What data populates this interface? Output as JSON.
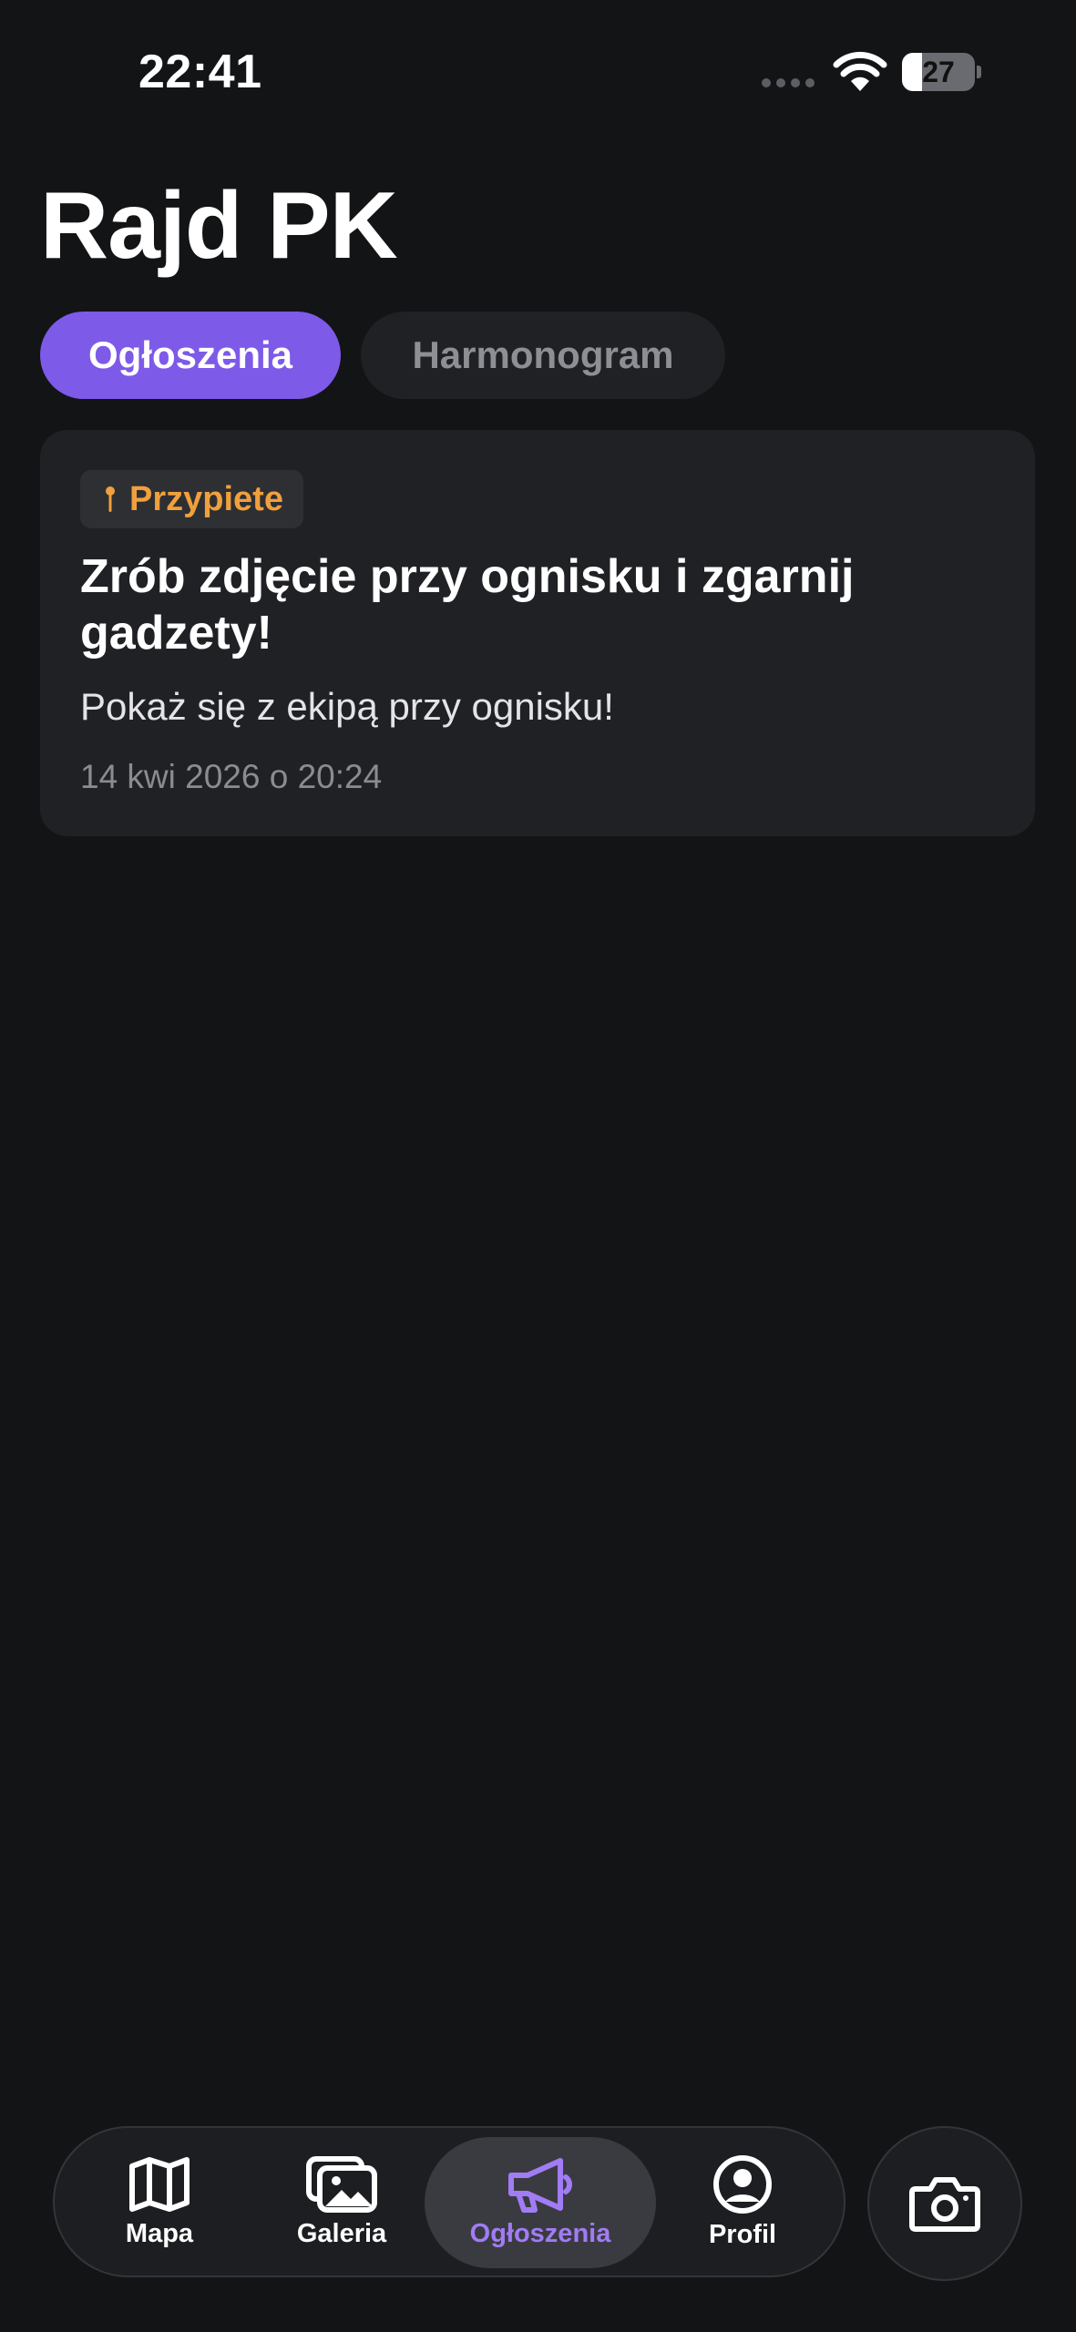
{
  "status_bar": {
    "time": "22:41",
    "battery_level": "27",
    "battery_fraction": 0.27
  },
  "header": {
    "title": "Rajd PK"
  },
  "tabs": [
    {
      "label": "Ogłoszenia",
      "active": true
    },
    {
      "label": "Harmonogram",
      "active": false
    }
  ],
  "announcement": {
    "badge_icon": "pin-icon",
    "badge_label": "Przypiete",
    "title": "Zrób zdjęcie przy ognisku i zgarnij gadzety!",
    "body": "Pokaż się z ekipą przy ognisku!",
    "date": "14 kwi 2026 o 20:24"
  },
  "bottom_nav": {
    "items": [
      {
        "label": "Mapa",
        "icon": "map-icon",
        "active": false
      },
      {
        "label": "Galeria",
        "icon": "gallery-icon",
        "active": false
      },
      {
        "label": "Ogłoszenia",
        "icon": "megaphone-icon",
        "active": true
      },
      {
        "label": "Profil",
        "icon": "profile-icon",
        "active": false
      }
    ],
    "action_icon": "camera-icon"
  },
  "colors": {
    "background": "#131416",
    "accent": "#7d5ae8",
    "accent_text": "#a17cf5",
    "pinned": "#f0a03c",
    "card": "#202125"
  }
}
